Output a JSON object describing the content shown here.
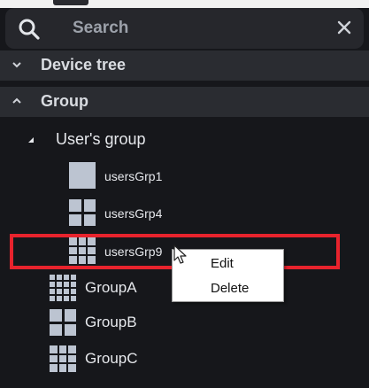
{
  "search": {
    "placeholder": "Search"
  },
  "sections": {
    "device_tree": {
      "label": "Device tree",
      "expanded": false
    },
    "group": {
      "label": "Group",
      "expanded": true
    }
  },
  "tree": {
    "root": {
      "label": "User's group",
      "expanded": true
    },
    "children": [
      {
        "label": "usersGrp1",
        "icon": "single-view-icon"
      },
      {
        "label": "usersGrp4",
        "icon": "grid-2x2-icon"
      },
      {
        "label": "usersGrp9",
        "icon": "grid-3x3-icon",
        "highlighted": true
      }
    ],
    "groups": [
      {
        "label": "GroupA",
        "icon": "grid-4x4-icon"
      },
      {
        "label": "GroupB",
        "icon": "grid-2x2-icon"
      },
      {
        "label": "GroupC",
        "icon": "grid-3x3-icon"
      }
    ]
  },
  "context_menu": {
    "items": [
      "Edit",
      "Delete"
    ]
  },
  "colors": {
    "panel_bg": "#16171b",
    "section_bg": "#2a2c31",
    "highlight": "#e8232d",
    "icon_fill": "#bcc4d1"
  }
}
